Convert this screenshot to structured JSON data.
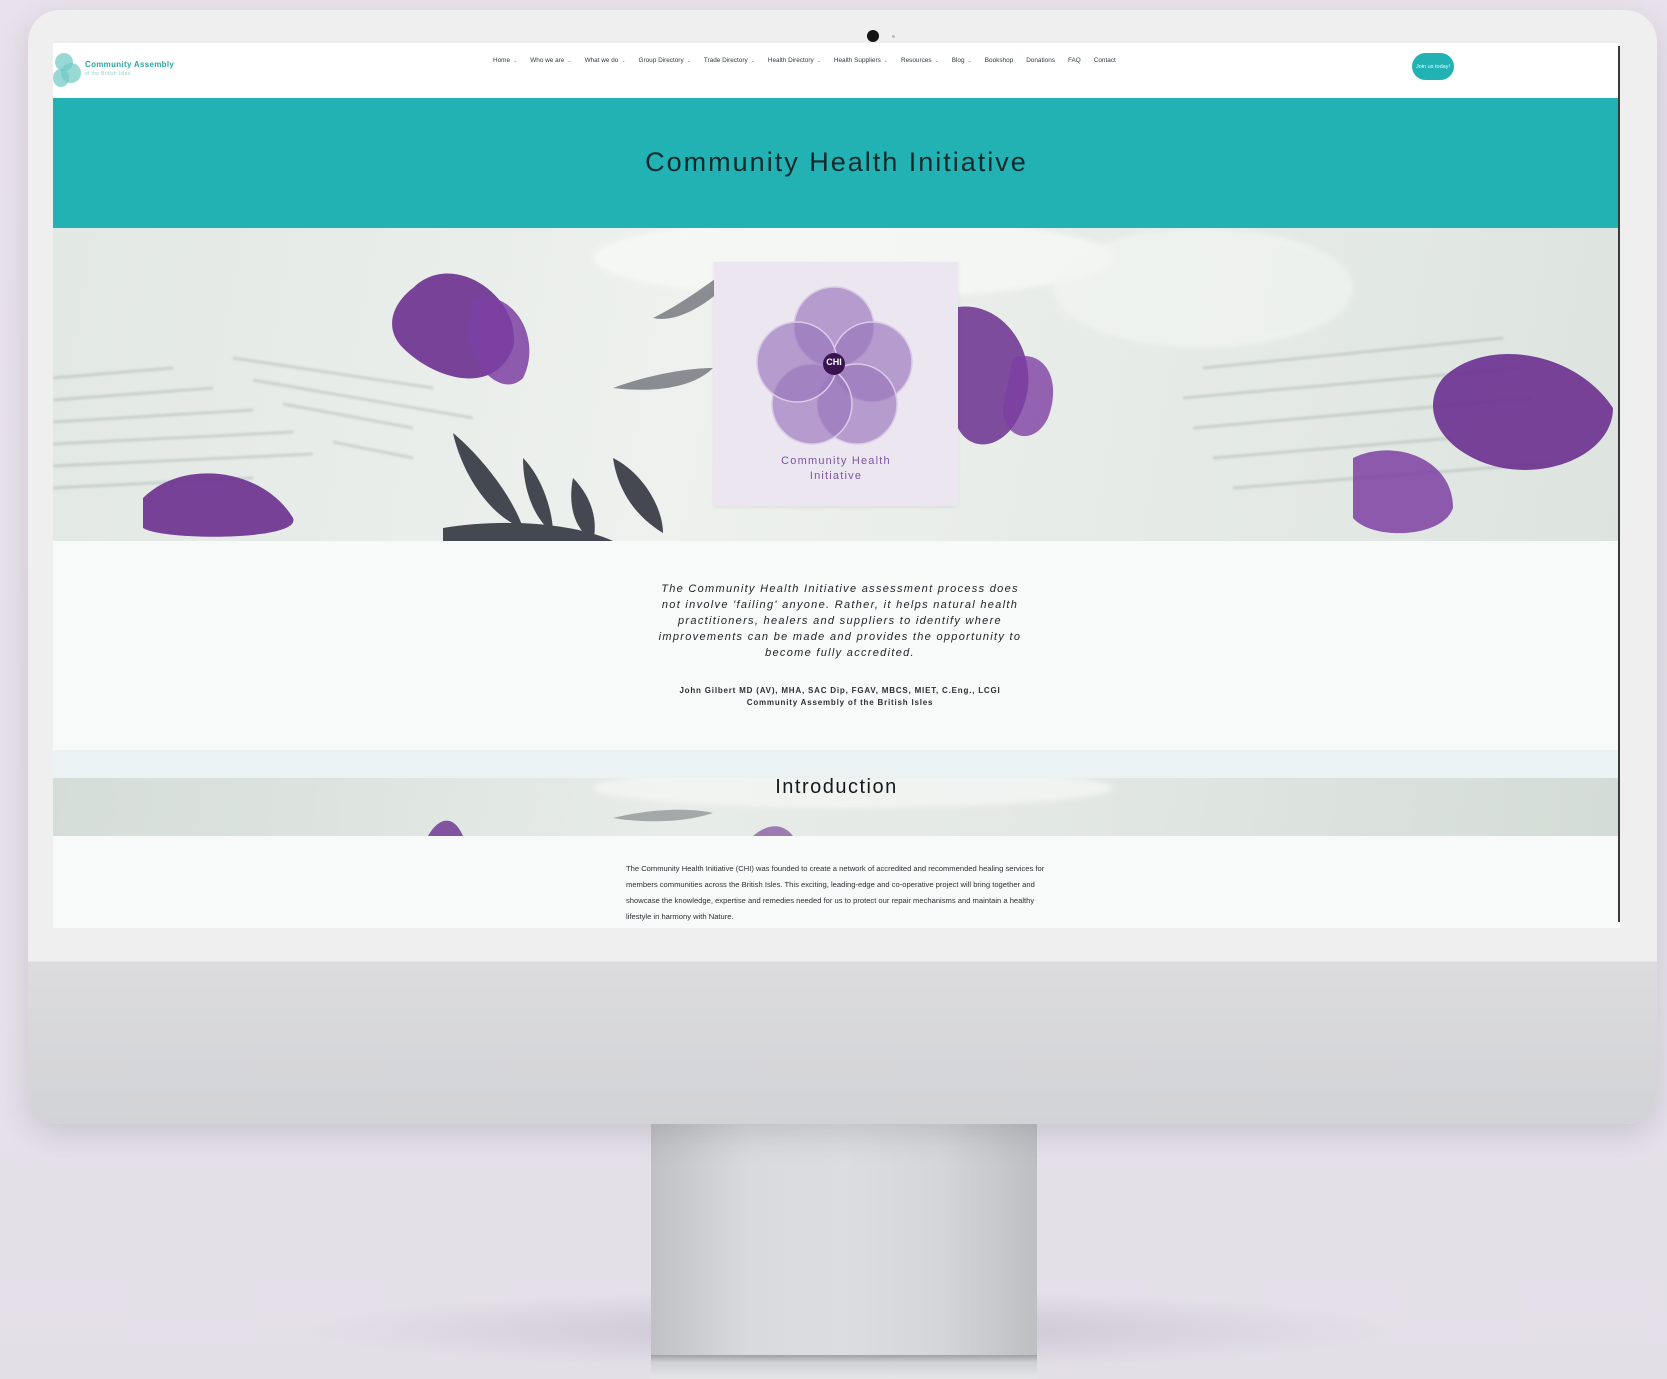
{
  "site": {
    "logo_line1": "Community Assembly",
    "logo_line2": "of the British Isles"
  },
  "nav": {
    "items": [
      {
        "label": "Home",
        "dropdown": true
      },
      {
        "label": "Who we are",
        "dropdown": true
      },
      {
        "label": "What we do",
        "dropdown": true
      },
      {
        "label": "Group Directory",
        "dropdown": true
      },
      {
        "label": "Trade Directory",
        "dropdown": true
      },
      {
        "label": "Health Directory",
        "dropdown": true
      },
      {
        "label": "Health Suppliers",
        "dropdown": true
      },
      {
        "label": "Resources",
        "dropdown": true
      },
      {
        "label": "Blog",
        "dropdown": true
      },
      {
        "label": "Bookshop",
        "dropdown": false
      },
      {
        "label": "Donations",
        "dropdown": false
      },
      {
        "label": "FAQ",
        "dropdown": false
      },
      {
        "label": "Contact",
        "dropdown": false
      }
    ],
    "join_label": "Join us today!"
  },
  "hero": {
    "title": "Community Health Initiative"
  },
  "chi_logo": {
    "badge": "CHI",
    "caption_line1": "Community Health",
    "caption_line2": "Initiative"
  },
  "quote": {
    "text": "The Community Health Initiative assessment process does not involve 'failing' anyone. Rather, it helps natural health practitioners, healers and suppliers to identify where improvements can be made and provides the opportunity to become fully accredited.",
    "author_line1": "John Gilbert MD (AV), MHA, SAC Dip, FGAV, MBCS, MIET, C.Eng., LCGI",
    "author_line2": "Community Assembly of the British Isles"
  },
  "intro": {
    "title": "Introduction",
    "text": "The Community Health Initiative (CHI) was founded to create a network of accredited and recommended healing services for members communities across the British Isles. This exciting, leading-edge and co-operative project will bring together and showcase the knowledge, expertise and remedies needed for us to protect our repair mechanisms and maintain a healthy lifestyle in harmony with Nature."
  },
  "colors": {
    "teal": "#23b2b4",
    "purple": "#7d55a3",
    "badge": "#3a1450"
  }
}
